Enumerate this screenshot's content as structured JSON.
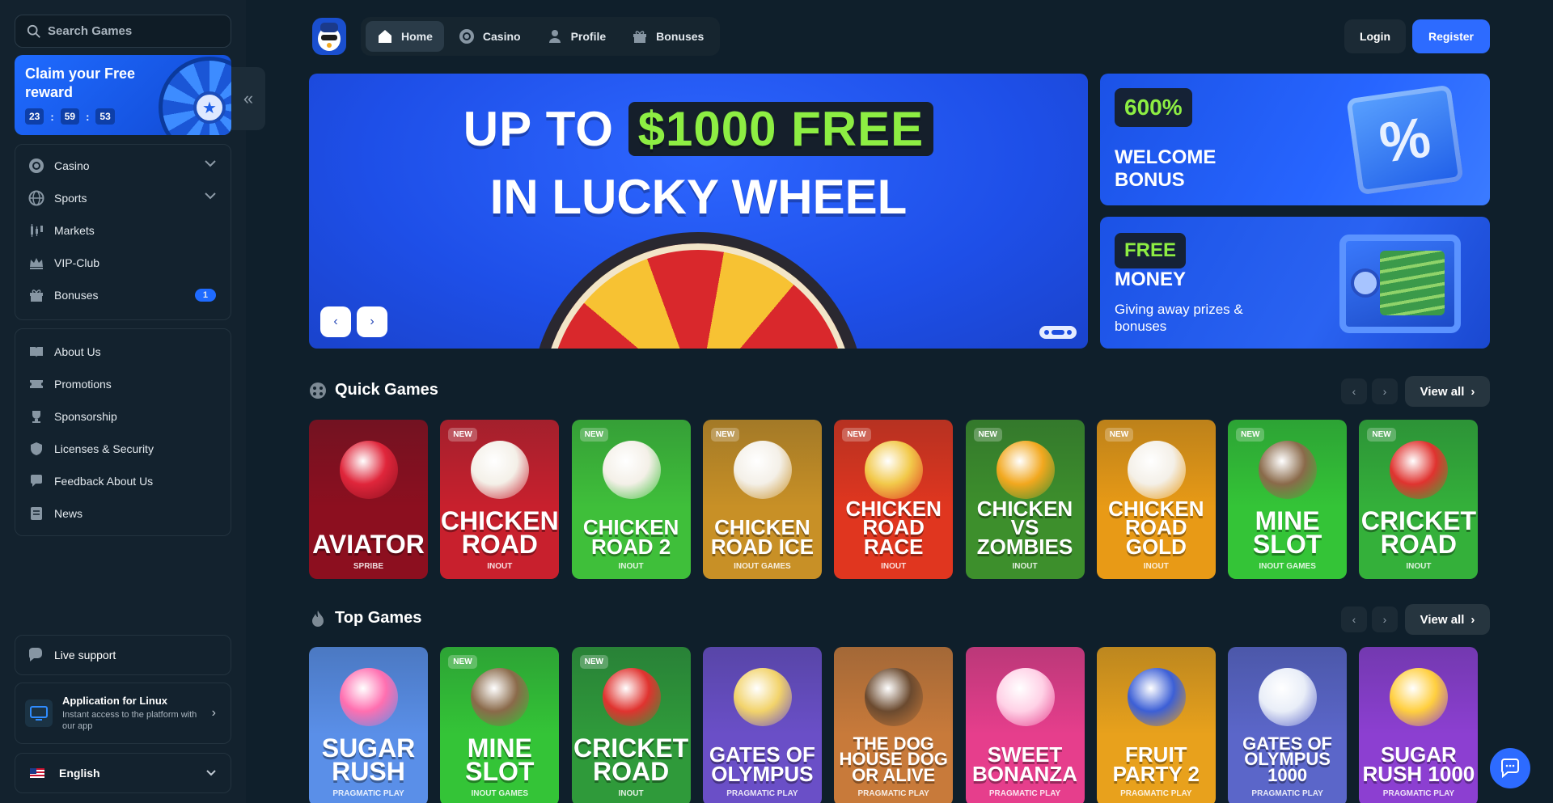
{
  "search": {
    "placeholder": "Search Games"
  },
  "promo": {
    "title": "Claim your Free reward",
    "timer": [
      "23",
      "59",
      "53"
    ]
  },
  "nav_menu": [
    {
      "label": "Casino",
      "icon": "casino-chip-icon",
      "expandable": true
    },
    {
      "label": "Sports",
      "icon": "globe-icon",
      "expandable": true
    },
    {
      "label": "Markets",
      "icon": "candlestick-icon"
    },
    {
      "label": "VIP-Club",
      "icon": "crown-icon"
    },
    {
      "label": "Bonuses",
      "icon": "gift-icon",
      "badge": "1"
    }
  ],
  "info_menu": [
    {
      "label": "About Us",
      "icon": "book-icon"
    },
    {
      "label": "Promotions",
      "icon": "ticket-icon"
    },
    {
      "label": "Sponsorship",
      "icon": "trophy-icon"
    },
    {
      "label": "Licenses & Security",
      "icon": "shield-icon"
    },
    {
      "label": "Feedback About Us",
      "icon": "feedback-icon"
    },
    {
      "label": "News",
      "icon": "newspaper-icon"
    }
  ],
  "support": {
    "label": "Live support"
  },
  "app_banner": {
    "title": "Application for Linux",
    "subtitle": "Instant access to the platform with our app"
  },
  "language": {
    "label": "English"
  },
  "header": {
    "tabs": [
      {
        "label": "Home",
        "icon": "home-icon",
        "active": true
      },
      {
        "label": "Casino",
        "icon": "casino-chip-icon"
      },
      {
        "label": "Profile",
        "icon": "user-icon"
      },
      {
        "label": "Bonuses",
        "icon": "gift-icon"
      }
    ],
    "login": "Login",
    "register": "Register"
  },
  "hero": {
    "line1_pre": "UP TO",
    "line1_highlight": "$1000 FREE",
    "line2": "IN LUCKY WHEEL"
  },
  "side_banners": [
    {
      "pill": "600%",
      "title": "WELCOME BONUS"
    },
    {
      "pill": "FREE",
      "title": "MONEY",
      "subtitle": "Giving away prizes & bonuses"
    }
  ],
  "quick_games": {
    "title": "Quick Games",
    "view_all": "View all",
    "games": [
      {
        "name": "AVIATOR",
        "provider": "SPRIBE",
        "new": false,
        "bg": "#8c0f1f",
        "accent": "#e0263b"
      },
      {
        "name": "CHICKEN ROAD",
        "provider": "INOUT",
        "new": true,
        "bg": "#c8202d",
        "accent": "#f4f0e8"
      },
      {
        "name": "CHICKEN ROAD 2",
        "provider": "INOUT",
        "new": true,
        "bg": "#3fbf3a",
        "accent": "#f4f0e8"
      },
      {
        "name": "CHICKEN ROAD ICE",
        "provider": "INOUT GAMES",
        "new": true,
        "bg": "#c89026",
        "accent": "#f4f0e8"
      },
      {
        "name": "CHICKEN ROAD RACE",
        "provider": "INOUT",
        "new": true,
        "bg": "#e0361f",
        "accent": "#f2c94a"
      },
      {
        "name": "CHICKEN VS ZOMBIES",
        "provider": "INOUT",
        "new": true,
        "bg": "#3d8f2c",
        "accent": "#f2a81f"
      },
      {
        "name": "CHICKEN ROAD GOLD",
        "provider": "INOUT",
        "new": true,
        "bg": "#e89a16",
        "accent": "#f4f0e8"
      },
      {
        "name": "MINE SLOT",
        "provider": "INOUT GAMES",
        "new": true,
        "bg": "#34c437",
        "accent": "#8a6a4a"
      },
      {
        "name": "CRICKET ROAD",
        "provider": "INOUT",
        "new": true,
        "bg": "#34b03a",
        "accent": "#e0332f"
      }
    ]
  },
  "top_games": {
    "title": "Top Games",
    "view_all": "View all",
    "games": [
      {
        "name": "SUGAR RUSH",
        "provider": "PRAGMATIC PLAY",
        "new": false,
        "bg": "#5a8fe8",
        "accent": "#ff6fb0"
      },
      {
        "name": "MINE SLOT",
        "provider": "INOUT GAMES",
        "new": true,
        "bg": "#34c437",
        "accent": "#8a6a4a"
      },
      {
        "name": "CRICKET ROAD",
        "provider": "INOUT",
        "new": true,
        "bg": "#2f9a3a",
        "accent": "#e0332f"
      },
      {
        "name": "GATES OF OLYMPUS",
        "provider": "PRAGMATIC PLAY",
        "new": false,
        "bg": "#6a4fc7",
        "accent": "#f2d36b"
      },
      {
        "name": "THE DOG HOUSE DOG OR ALIVE",
        "provider": "PRAGMATIC PLAY",
        "new": false,
        "bg": "#c87a3a",
        "accent": "#6b4a2f"
      },
      {
        "name": "SWEET BONANZA",
        "provider": "PRAGMATIC PLAY",
        "new": false,
        "bg": "#e63e8c",
        "accent": "#ffd1e6"
      },
      {
        "name": "FRUIT PARTY 2",
        "provider": "PRAGMATIC PLAY",
        "new": false,
        "bg": "#e8a11c",
        "accent": "#3c5fd6"
      },
      {
        "name": "GATES OF OLYMPUS 1000",
        "provider": "PRAGMATIC PLAY",
        "new": false,
        "bg": "#5b66c9",
        "accent": "#e9eef8"
      },
      {
        "name": "SUGAR RUSH 1000",
        "provider": "PRAGMATIC PLAY",
        "new": false,
        "bg": "#8c3fd1",
        "accent": "#ffcf3f"
      }
    ]
  },
  "colors": {
    "accent": "#2d6bff",
    "highlight": "#8dee43",
    "bg": "#0f1f2b",
    "sidebar": "#13222e"
  }
}
